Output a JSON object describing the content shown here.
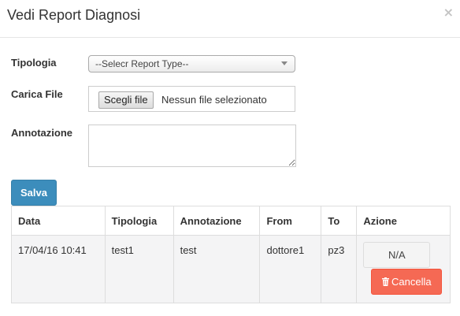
{
  "modal": {
    "title": "Vedi Report Diagnosi",
    "close_glyph": "×"
  },
  "form": {
    "tipologia_label": "Tipologia",
    "tipologia_selected": "--Selecr Report Type--",
    "carica_file_label": "Carica File",
    "file_button_label": "Scegli file",
    "file_status": "Nessun file selezionato",
    "annotazione_label": "Annotazione",
    "annotazione_value": "",
    "save_label": "Salva"
  },
  "table": {
    "headers": [
      "Data",
      "Tipologia",
      "Annotazione",
      "From",
      "To",
      "Azione"
    ],
    "rows": [
      {
        "data": "17/04/16 10:41",
        "tipologia": "test1",
        "annotazione": "test",
        "from": "dottore1",
        "to": "pz3",
        "action_primary_label": "N/A",
        "action_delete_label": "Cancella"
      }
    ]
  },
  "icons": {
    "close": "close-icon",
    "select_arrow": "chevron-down-icon",
    "delete": "trash-icon"
  },
  "colors": {
    "primary": "#3c8dbc",
    "danger": "#f56954",
    "row_bg": "#f4f4f5"
  }
}
